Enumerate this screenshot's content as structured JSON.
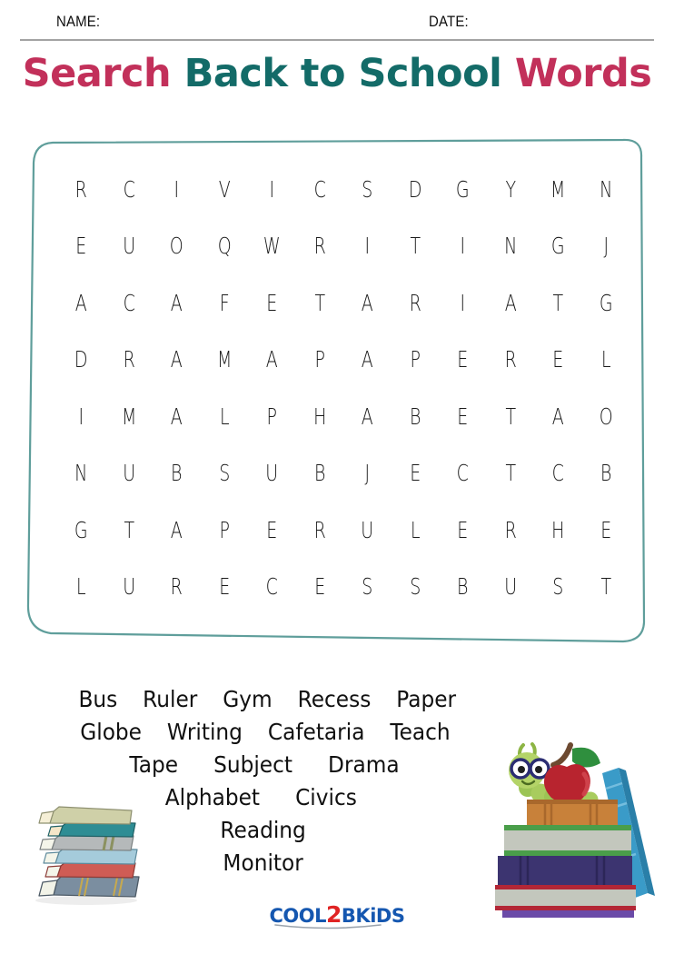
{
  "header": {
    "name_label": "NAME:",
    "date_label": "DATE:"
  },
  "title": {
    "part1": "Search ",
    "part2": "Back to School ",
    "part3": "Words",
    "color_pink": "#c2305a",
    "color_teal": "#136b68"
  },
  "puzzle": {
    "border_color": "#5f9e9b",
    "rows": 8,
    "cols": 12,
    "grid": [
      [
        "R",
        "C",
        "I",
        "V",
        "I",
        "C",
        "S",
        "D",
        "G",
        "Y",
        "M",
        "N"
      ],
      [
        "E",
        "U",
        "O",
        "Q",
        "W",
        "R",
        "I",
        "T",
        "I",
        "N",
        "G",
        "J"
      ],
      [
        "A",
        "C",
        "A",
        "F",
        "E",
        "T",
        "A",
        "R",
        "I",
        "A",
        "T",
        "G"
      ],
      [
        "D",
        "R",
        "A",
        "M",
        "A",
        "P",
        "A",
        "P",
        "E",
        "R",
        "E",
        "L"
      ],
      [
        "I",
        "M",
        "A",
        "L",
        "P",
        "H",
        "A",
        "B",
        "E",
        "T",
        "A",
        "O"
      ],
      [
        "N",
        "U",
        "B",
        "S",
        "U",
        "B",
        "J",
        "E",
        "C",
        "T",
        "C",
        "B"
      ],
      [
        "G",
        "T",
        "A",
        "P",
        "E",
        "R",
        "U",
        "L",
        "E",
        "R",
        "H",
        "E"
      ],
      [
        "L",
        "U",
        "R",
        "E",
        "C",
        "E",
        "S",
        "S",
        "B",
        "U",
        "S",
        "T"
      ]
    ]
  },
  "wordlist": {
    "rows": [
      [
        "Bus",
        "Ruler",
        "Gym",
        "Recess",
        "Paper"
      ],
      [
        "Globe",
        "Writing",
        "Cafetaria",
        "Teach"
      ],
      [
        "Tape",
        "Subject",
        "Drama"
      ],
      [
        "Alphabet",
        "Civics"
      ],
      [
        "Reading"
      ],
      [
        "Monitor"
      ]
    ],
    "all_words": [
      "Bus",
      "Ruler",
      "Gym",
      "Recess",
      "Paper",
      "Globe",
      "Writing",
      "Cafetaria",
      "Teach",
      "Tape",
      "Subject",
      "Drama",
      "Alphabet",
      "Civics",
      "Reading",
      "Monitor"
    ]
  },
  "logo": {
    "part1": "COOL",
    "part2": "2",
    "part3": "BK",
    "part4": "i",
    "part5": "DS",
    "color_blue": "#1557b0",
    "color_red": "#e02424"
  },
  "illustrations": {
    "left": {
      "name": "stack-of-books",
      "book_colors": [
        "#cfd0a8",
        "#2e8d94",
        "#b5b9ba",
        "#a5cbdb",
        "#cf5c55",
        "#7b8ea0"
      ]
    },
    "right": {
      "name": "caterpillar-apple-books",
      "caterpillar_color": "#a8cc5e",
      "glasses_color": "#2b2d72",
      "apple_color": "#b8242f",
      "leaf_color": "#2f8f3e",
      "stem_color": "#6d4a31",
      "book_colors": [
        "#c8813a",
        "#4a9e4a",
        "#3c3470",
        "#b32736",
        "#6b4ba8",
        "#3a9bc8"
      ]
    }
  }
}
